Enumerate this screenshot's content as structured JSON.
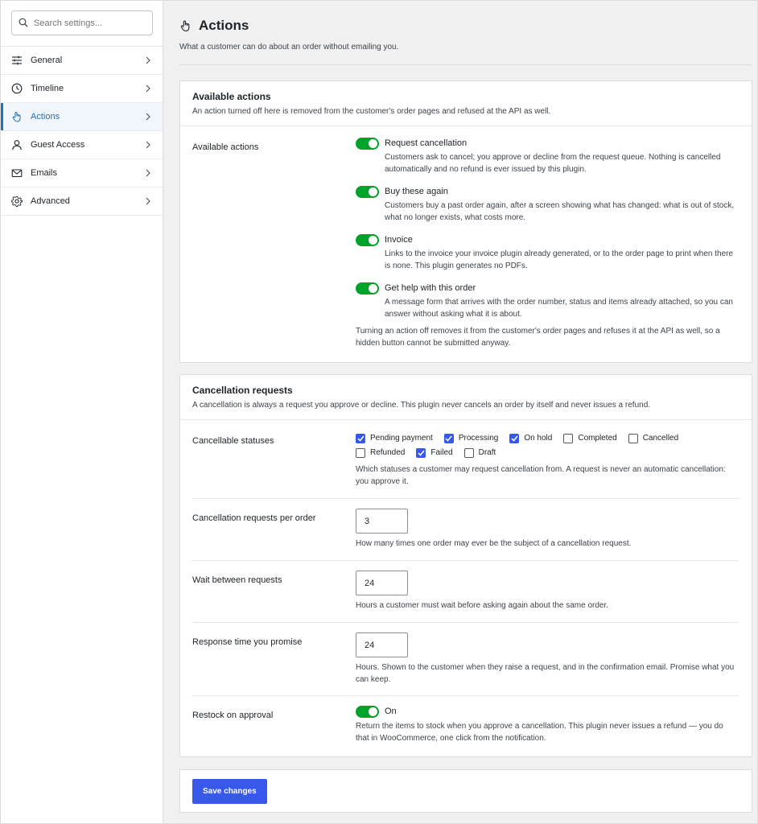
{
  "search": {
    "placeholder": "Search settings..."
  },
  "sidebar": {
    "items": [
      {
        "label": "General",
        "icon": "sliders-icon"
      },
      {
        "label": "Timeline",
        "icon": "clock-icon"
      },
      {
        "label": "Actions",
        "icon": "hand-pointer-icon",
        "active": true
      },
      {
        "label": "Guest Access",
        "icon": "user-icon"
      },
      {
        "label": "Emails",
        "icon": "envelope-icon"
      },
      {
        "label": "Advanced",
        "icon": "gear-icon"
      }
    ]
  },
  "page": {
    "title": "Actions",
    "subtitle": "What a customer can do about an order without emailing you."
  },
  "available": {
    "title": "Available actions",
    "desc": "An action turned off here is removed from the customer's order pages and refused at the API as well.",
    "row_label": "Available actions",
    "options": [
      {
        "title": "Request cancellation",
        "enabled": true,
        "desc": "Customers ask to cancel; you approve or decline from the request queue. Nothing is cancelled automatically and no refund is ever issued by this plugin."
      },
      {
        "title": "Buy these again",
        "enabled": true,
        "desc": "Customers buy a past order again, after a screen showing what has changed: what is out of stock, what no longer exists, what costs more."
      },
      {
        "title": "Invoice",
        "enabled": true,
        "desc": "Links to the invoice your invoice plugin already generated, or to the order page to print when there is none. This plugin generates no PDFs."
      },
      {
        "title": "Get help with this order",
        "enabled": true,
        "desc": "A message form that arrives with the order number, status and items already attached, so you can answer without asking what it is about."
      }
    ],
    "footnote": "Turning an action off removes it from the customer's order pages and refuses it at the API as well, so a hidden button cannot be submitted anyway."
  },
  "cancellation": {
    "title": "Cancellation requests",
    "desc": "A cancellation is always a request you approve or decline. This plugin never cancels an order by itself and never issues a refund.",
    "statuses_label": "Cancellable statuses",
    "statuses": [
      {
        "label": "Pending payment",
        "checked": true
      },
      {
        "label": "Processing",
        "checked": true
      },
      {
        "label": "On hold",
        "checked": true
      },
      {
        "label": "Completed",
        "checked": false
      },
      {
        "label": "Cancelled",
        "checked": false
      },
      {
        "label": "Refunded",
        "checked": false
      },
      {
        "label": "Failed",
        "checked": true
      },
      {
        "label": "Draft",
        "checked": false
      }
    ],
    "statuses_help": "Which statuses a customer may request cancellation from. A request is never an automatic cancellation: you approve it.",
    "per_order_label": "Cancellation requests per order",
    "per_order_value": "3",
    "per_order_help": "How many times one order may ever be the subject of a cancellation request.",
    "wait_label": "Wait between requests",
    "wait_value": "24",
    "wait_help": "Hours a customer must wait before asking again about the same order.",
    "response_label": "Response time you promise",
    "response_value": "24",
    "response_help": "Hours. Shown to the customer when they raise a request, and in the confirmation email. Promise what you can keep.",
    "restock_label": "Restock on approval",
    "restock_state": "On",
    "restock_enabled": true,
    "restock_help": "Return the items to stock when you approve a cancellation. This plugin never issues a refund — you do that in WooCommerce, one click from the notification."
  },
  "footer": {
    "save_label": "Save changes"
  },
  "colors": {
    "accent": "#2271b1",
    "toggle_on": "#00a32a",
    "primary_button": "#3858e9"
  }
}
